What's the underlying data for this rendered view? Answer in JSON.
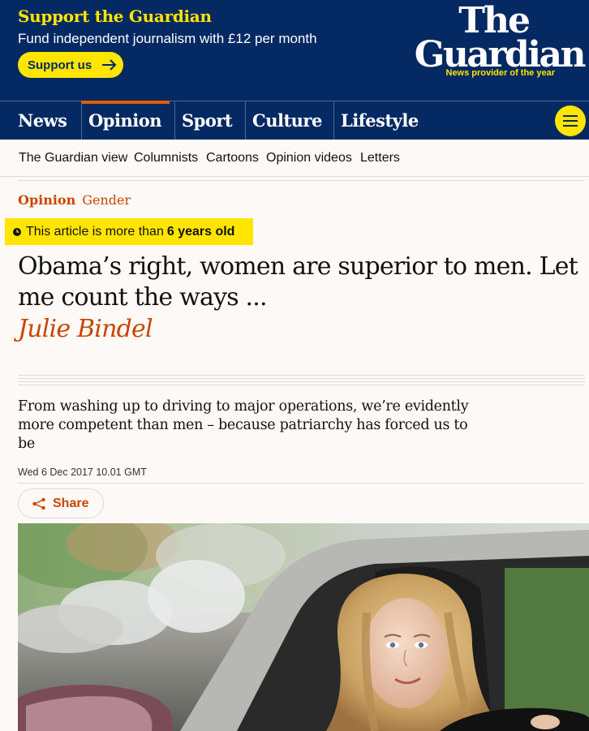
{
  "header": {
    "support_title": "Support the Guardian",
    "support_subtitle": "Fund independent journalism with £12 per month",
    "support_button": "Support us",
    "logo_the": "The",
    "logo_guardian": "Guardian",
    "logo_tagline": "News provider of the year"
  },
  "nav": {
    "items": [
      {
        "label": "News",
        "active": false
      },
      {
        "label": "Opinion",
        "active": true
      },
      {
        "label": "Sport",
        "active": false
      },
      {
        "label": "Culture",
        "active": false
      },
      {
        "label": "Lifestyle",
        "active": false
      }
    ],
    "menu_icon": "hamburger-icon"
  },
  "subnav": {
    "items": [
      "The Guardian view",
      "Columnists",
      "Cartoons",
      "Opinion videos",
      "Letters"
    ]
  },
  "article": {
    "section": "Opinion",
    "tag": "Gender",
    "age_prefix": "This article is more than",
    "age_value": "6 years old",
    "headline": "Obama’s right, women are superior to men. Let me count the ways ...",
    "byline": "Julie Bindel",
    "standfirst": "From washing up to driving to major operations, we’re evidently more competent than men – because patriarchy has forced us to be",
    "dateline": "Wed 6 Dec 2017 10.01 GMT",
    "share_label": "Share"
  },
  "colors": {
    "brand_blue": "#052962",
    "highlight_yellow": "#ffe500",
    "opinion_orange": "#c74600",
    "background": "#fdf9f6"
  }
}
